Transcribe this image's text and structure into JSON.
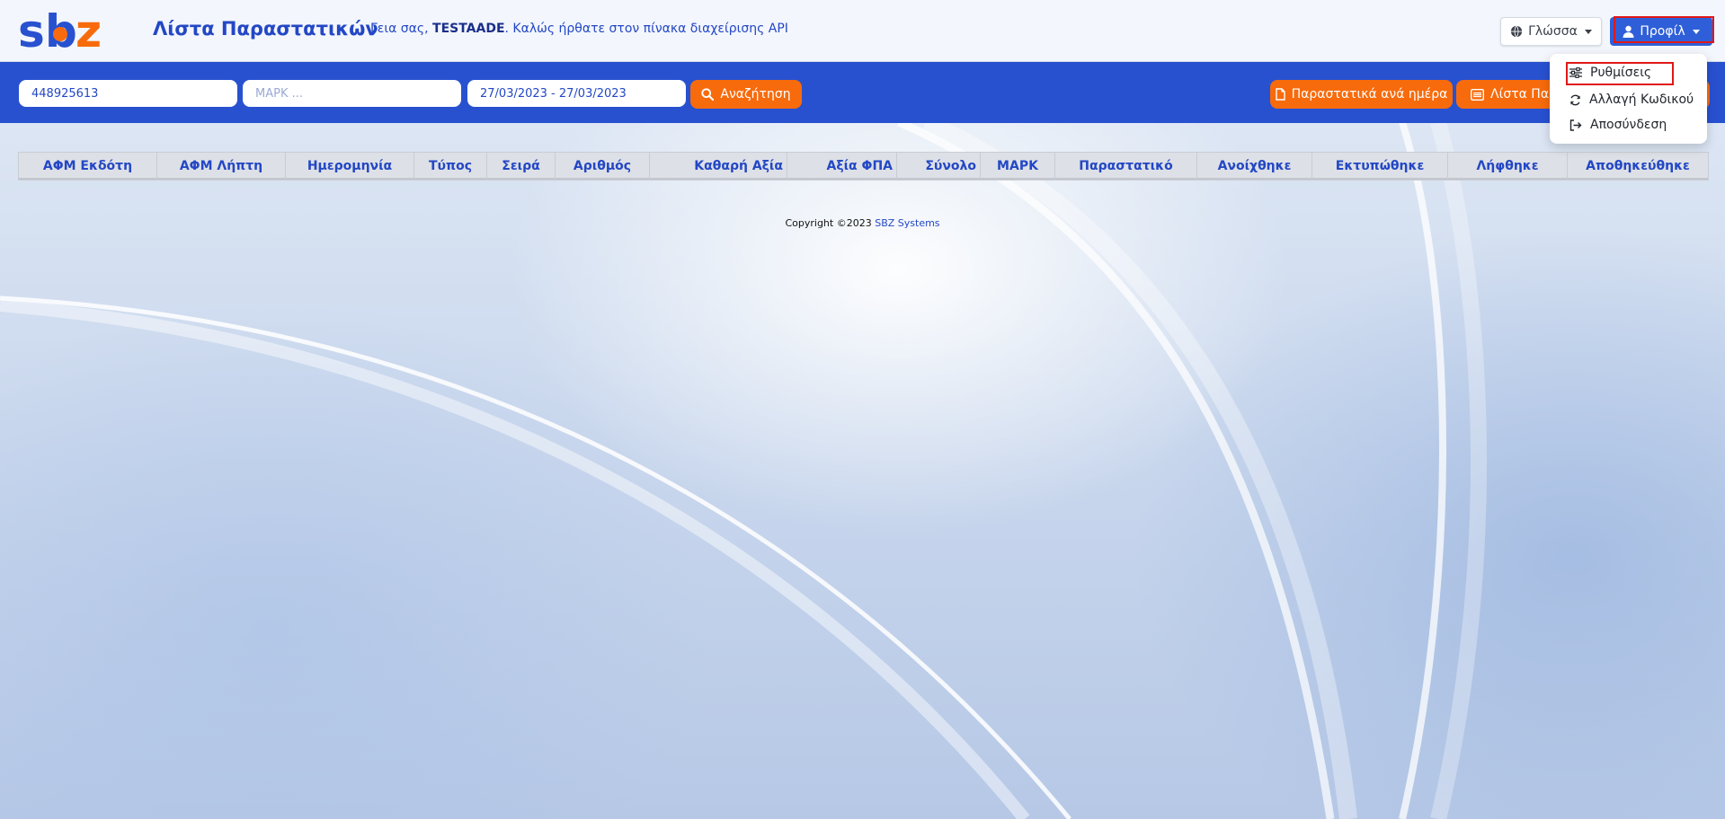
{
  "brand": {
    "logo_text": "sbz",
    "colors": {
      "blue": "#2851d0",
      "orange": "#f76b0c",
      "highlight": "#e01818"
    }
  },
  "header": {
    "title": "Λίστα Παραστατικών",
    "greeting_prefix": "Γεια σας, ",
    "user": "TESTAADE",
    "greeting_suffix": ". Καλώς ήρθατε στον πίνακα διαχείρισης API",
    "language_label": "Γλώσσα",
    "profile_label": "Προφίλ"
  },
  "profile_menu": {
    "items": [
      {
        "icon": "sliders-icon",
        "label": "Ρυθμίσεις"
      },
      {
        "icon": "refresh-icon",
        "label": "Αλλαγή Κωδικού"
      },
      {
        "icon": "logout-icon",
        "label": "Αποσύνδεση"
      }
    ]
  },
  "search": {
    "afm_value": "448925613",
    "mark_placeholder": "ΜΑΡΚ ...",
    "date_range_value": "27/03/2023 - 27/03/2023",
    "search_label": "Αναζήτηση",
    "per_day_label": "Παραστατικά ανά ημέρα",
    "list_label": "Λίστα Παραστατικών"
  },
  "table": {
    "columns": [
      "ΑΦΜ Εκδότη",
      "ΑΦΜ Λήπτη",
      "Ημερομηνία",
      "Τύπος",
      "Σειρά",
      "Αριθμός",
      "Καθαρή Αξία",
      "Αξία ΦΠΑ",
      "Σύνολο",
      "ΜΑΡΚ",
      "Παραστατικό",
      "Ανοίχθηκε",
      "Εκτυπώθηκε",
      "Λήφθηκε",
      "Αποθηκεύθηκε"
    ]
  },
  "footer": {
    "copyright": "Copyright ©2023 ",
    "company": "SBZ Systems"
  }
}
